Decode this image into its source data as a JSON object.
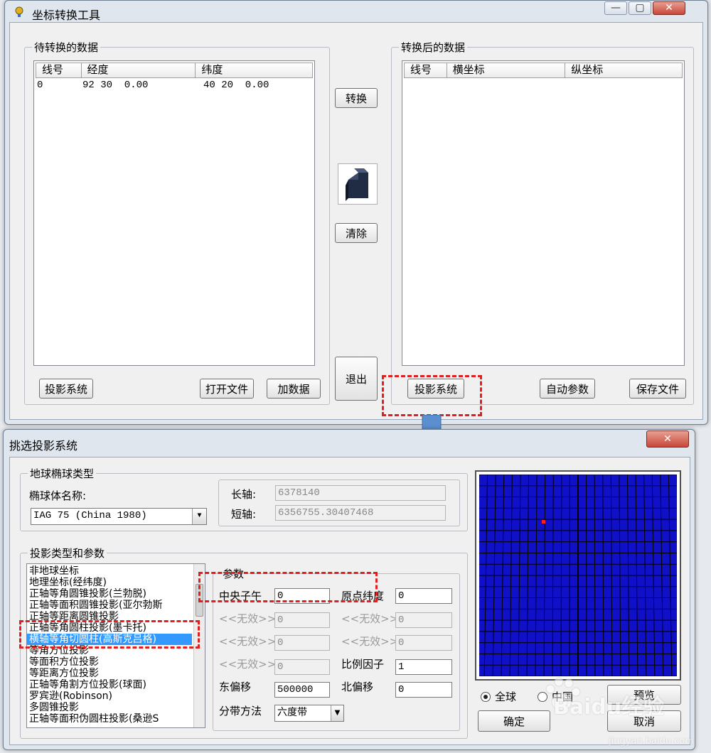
{
  "main_window": {
    "title": "坐标转换工具",
    "minimize_glyph": "—",
    "maximize_glyph": "▢",
    "close_glyph": "✕",
    "left_group": {
      "title": "待转换的数据",
      "columns": [
        "线号",
        "经度",
        "纬度"
      ],
      "rows": [
        {
          "line": "0",
          "lon": "92 30  0.00",
          "lat": "40 20  0.00"
        }
      ],
      "btn_projection": "投影系统",
      "btn_open": "打开文件",
      "btn_add": "加数据"
    },
    "center": {
      "btn_convert": "转换",
      "btn_clear": "清除",
      "btn_exit": "退出"
    },
    "right_group": {
      "title": "转换后的数据",
      "columns": [
        "线号",
        "横坐标",
        "纵坐标"
      ],
      "btn_projection": "投影系统",
      "btn_auto": "自动参数",
      "btn_save": "保存文件"
    }
  },
  "dialog": {
    "title": "挑选投影系统",
    "close_glyph": "✕",
    "ellipsoid_group": {
      "title": "地球椭球类型",
      "name_label": "椭球体名称:",
      "name_value": "IAG 75 (China 1980)",
      "major_label": "长轴:",
      "major_value": "6378140",
      "minor_label": "短轴:",
      "minor_value": "6356755.30407468"
    },
    "projection_group": {
      "title": "投影类型和参数",
      "items": [
        "非地球坐标",
        "地理坐标(经纬度)",
        "正轴等角圆锥投影(兰勃脱)",
        "正轴等面积圆锥投影(亚尔勃斯",
        "正轴等距离圆锥投影",
        "正轴等角圆柱投影(墨卡托)",
        "横轴等角切圆柱(高斯克吕格)",
        "等角方位投影",
        "等面积方位投影",
        "等距离方位投影",
        "正轴等角割方位投影(球面)",
        "罗宾逊(Robinson)",
        "多圆锥投影",
        "正轴等面积伪圆柱投影(桑逊S"
      ],
      "selected_index": 6,
      "params": {
        "title": "参数",
        "central_meridian_label": "中央子午",
        "central_meridian_value": "0",
        "origin_lat_label": "原点纬度",
        "origin_lat_value": "0",
        "invalid_label": "<<无效>>",
        "invalid_value": "0",
        "scale_label": "比例因子",
        "scale_value": "1",
        "false_east_label": "东偏移",
        "false_east_value": "500000",
        "false_north_label": "北偏移",
        "false_north_value": "0",
        "zone_label": "分带方法",
        "zone_value": "六度带"
      }
    },
    "preview": {
      "radio_global": "全球",
      "radio_china": "中国",
      "btn_preview": "预览",
      "btn_ok": "确定",
      "btn_cancel": "取消"
    }
  },
  "watermark": {
    "brand": "Baidu经验",
    "url": "jingyan.baidu.com"
  },
  "colors": {
    "annotation": "#e02020",
    "arrow": "#5b8fd0",
    "map_bg": "#1010c8",
    "selection": "#3399ff"
  }
}
